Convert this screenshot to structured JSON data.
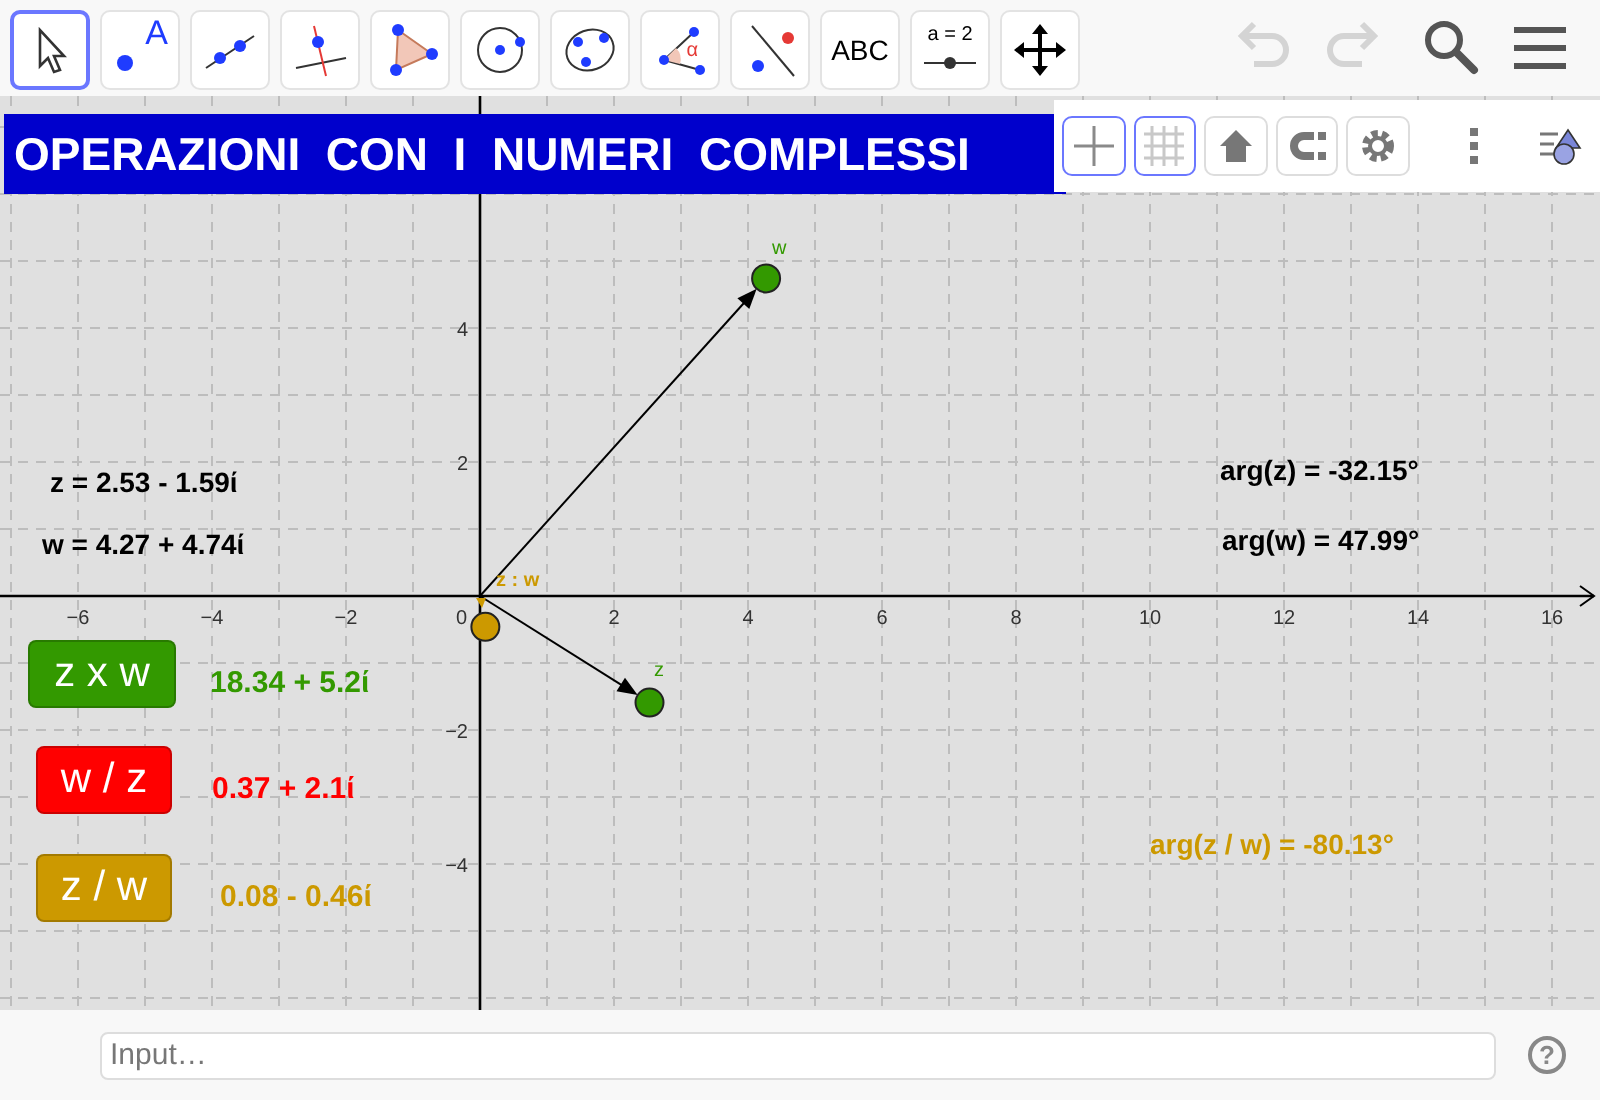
{
  "toolbar": {
    "tools": [
      {
        "kind": "move",
        "selected": true
      },
      {
        "kind": "point",
        "label": "A",
        "selected": false
      },
      {
        "kind": "line",
        "selected": false
      },
      {
        "kind": "perpendicular",
        "selected": false
      },
      {
        "kind": "polygon",
        "selected": false
      },
      {
        "kind": "circle",
        "selected": false
      },
      {
        "kind": "conic",
        "selected": false
      },
      {
        "kind": "angle",
        "label": "α",
        "selected": false
      },
      {
        "kind": "reflect",
        "selected": false
      },
      {
        "kind": "text",
        "label": "ABC",
        "selected": false
      },
      {
        "kind": "slider",
        "label": "a = 2",
        "selected": false
      },
      {
        "kind": "pan",
        "selected": false
      }
    ],
    "actions": [
      {
        "kind": "undo",
        "disabled": true
      },
      {
        "kind": "redo",
        "disabled": true
      },
      {
        "kind": "search",
        "disabled": false
      },
      {
        "kind": "menu",
        "disabled": false
      }
    ]
  },
  "title": "OPERAZIONI  CON  I  NUMERI  COMPLESSI",
  "style_bar": [
    {
      "kind": "axes",
      "selected": true
    },
    {
      "kind": "grid",
      "selected": true
    },
    {
      "kind": "home",
      "selected": false
    },
    {
      "kind": "magnet",
      "selected": false
    },
    {
      "kind": "gear",
      "selected": false
    },
    {
      "kind": "more"
    },
    {
      "kind": "views"
    }
  ],
  "graph": {
    "x_ticks": [
      "−6",
      "−4",
      "−2",
      "2",
      "4",
      "6",
      "8",
      "10",
      "12",
      "14",
      "16"
    ],
    "origin": "0",
    "y_ticks": [
      "4",
      "2",
      "−2",
      "−4"
    ],
    "points": [
      {
        "label": "w",
        "color": "#339900"
      },
      {
        "label": "z",
        "color": "#339900"
      },
      {
        "label": "z : w",
        "color": "#cc9900"
      }
    ],
    "texts": [
      {
        "text": "z = 2.53 - 1.59ί",
        "color": "#000000"
      },
      {
        "text": "w = 4.27 + 4.74ί",
        "color": "#000000"
      },
      {
        "text": "arg(z) = -32.15°",
        "color": "#000000"
      },
      {
        "text": "arg(w) = 47.99°",
        "color": "#000000"
      },
      {
        "text": "arg(z / w) = -80.13°",
        "color": "#cc9900"
      }
    ],
    "operations": [
      {
        "label": "z x w",
        "result": "18.34 + 5.2ί",
        "color": "#339900"
      },
      {
        "label": "w / z",
        "result": "0.37 + 2.1ί",
        "color": "#ff0000"
      },
      {
        "label": "z / w",
        "result": "0.08 - 0.46ί",
        "color": "#cc9900"
      }
    ]
  },
  "input_bar": {
    "placeholder": "Input…",
    "help": "?"
  }
}
